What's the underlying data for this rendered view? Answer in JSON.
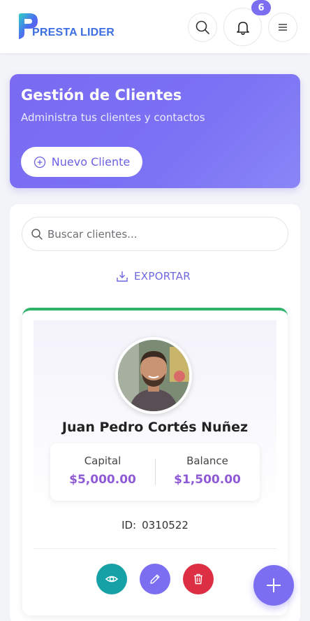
{
  "brand": {
    "logo_text_1": "PRESTA",
    "logo_text_2": " LIDER"
  },
  "header": {
    "notification_count": "6"
  },
  "hero": {
    "title": "Gestión de Clientes",
    "subtitle": "Administra tus clientes y contactos",
    "new_client_label": "Nuevo Cliente"
  },
  "search": {
    "placeholder": "Buscar clientes...",
    "value": ""
  },
  "export_label": "EXPORTAR",
  "client": {
    "name": "Juan Pedro Cortés Nuñez",
    "capital_label": "Capital",
    "capital_value": "$5,000.00",
    "balance_label": "Balance",
    "balance_value": "$1,500.00",
    "id_label": "ID:",
    "id_value": "0310522"
  },
  "colors": {
    "accent": "#7b6ef0",
    "card_top": "#2fb36a",
    "view": "#16a1a7",
    "delete": "#dc2f43",
    "money": "#8e5ad6"
  }
}
